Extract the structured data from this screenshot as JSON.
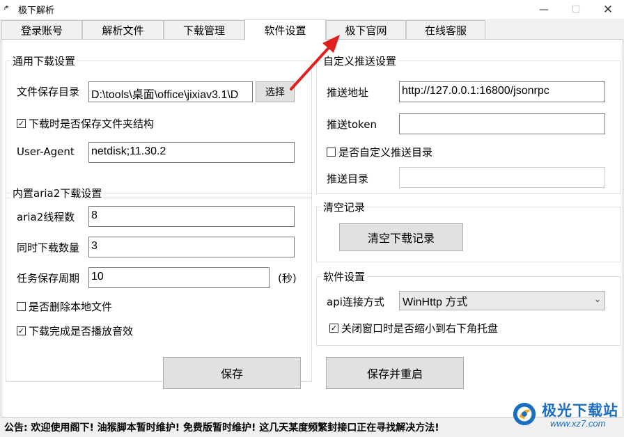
{
  "window": {
    "title": "极下解析",
    "icon_text": "ᵢᵈᵗ",
    "min_glyph": "—",
    "max_glyph": "☐",
    "close_glyph": "✕"
  },
  "tabs": [
    {
      "label": "登录账号"
    },
    {
      "label": "解析文件"
    },
    {
      "label": "下载管理"
    },
    {
      "label": "软件设置",
      "active": true
    },
    {
      "label": "极下官网"
    },
    {
      "label": "在线客服"
    }
  ],
  "general": {
    "title": "通用下载设置",
    "save_dir_label": "文件保存目录",
    "save_dir_value": "D:\\tools\\桌面\\office\\jixiav3.1\\D",
    "choose_label": "选择",
    "keep_structure_label": "下载时是否保存文件夹结构",
    "keep_structure_checked": true,
    "ua_label": "User-Agent",
    "ua_value": "netdisk;11.30.2"
  },
  "aria2": {
    "title": "内置aria2下载设置",
    "threads_label": "aria2线程数",
    "threads_value": "8",
    "concurrent_label": "同时下载数量",
    "concurrent_value": "3",
    "period_label": "任务保存周期",
    "period_value": "10",
    "period_unit": "(秒)",
    "delete_local_label": "是否删除本地文件",
    "delete_local_checked": false,
    "play_sound_label": "下载完成是否播放音效",
    "play_sound_checked": true
  },
  "push": {
    "title": "自定义推送设置",
    "addr_label": "推送地址",
    "addr_value": "http://127.0.0.1:16800/jsonrpc",
    "token_label": "推送token",
    "token_value": "",
    "custom_dir_label": "是否自定义推送目录",
    "custom_dir_checked": false,
    "dir_label": "推送目录",
    "dir_value": ""
  },
  "clear": {
    "title": "清空记录",
    "button_label": "清空下载记录"
  },
  "software": {
    "title": "软件设置",
    "api_label": "api连接方式",
    "api_value": "WinHttp 方式",
    "tray_label": "关闭窗口时是否缩小到右下角托盘",
    "tray_checked": true
  },
  "actions": {
    "save_label": "保存",
    "save_restart_label": "保存并重启"
  },
  "status_text": "公告: 欢迎使用阁下! 油猴脚本暂时维护! 免费版暂时维护! 这几天某度频繁封接口正在寻找解决方法!",
  "watermark": {
    "name": "极光下载站",
    "url": "www.xz7.com"
  },
  "colors": {
    "arrow": "#e02020",
    "brand": "#1a6fc4"
  },
  "check_glyph": "✓"
}
